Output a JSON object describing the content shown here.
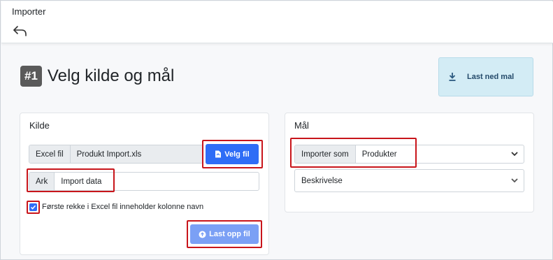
{
  "app": {
    "title": "Importer"
  },
  "heading": {
    "step": "#1",
    "title": "Velg kilde og mål"
  },
  "download": {
    "label": "Last ned mal"
  },
  "kilde": {
    "title": "Kilde",
    "file_label": "Excel fil",
    "file_value": "Produkt Import.xls",
    "choose_button": "Velg fil",
    "sheet_label": "Ark",
    "sheet_value": "Import data",
    "header_checkbox_label": "Første rekke i Excel fil inneholder kolonne navn",
    "header_checkbox_checked": true,
    "upload_button": "Last opp fil"
  },
  "mal": {
    "title": "Mål",
    "import_as_label": "Importer som",
    "import_as_value": "Produkter",
    "description_select": "Beskrivelse"
  },
  "colors": {
    "primary": "#2f6df6",
    "primary_disabled": "#7ba0f5",
    "highlight": "#c8151b",
    "download_bg": "#d3ecf5"
  }
}
